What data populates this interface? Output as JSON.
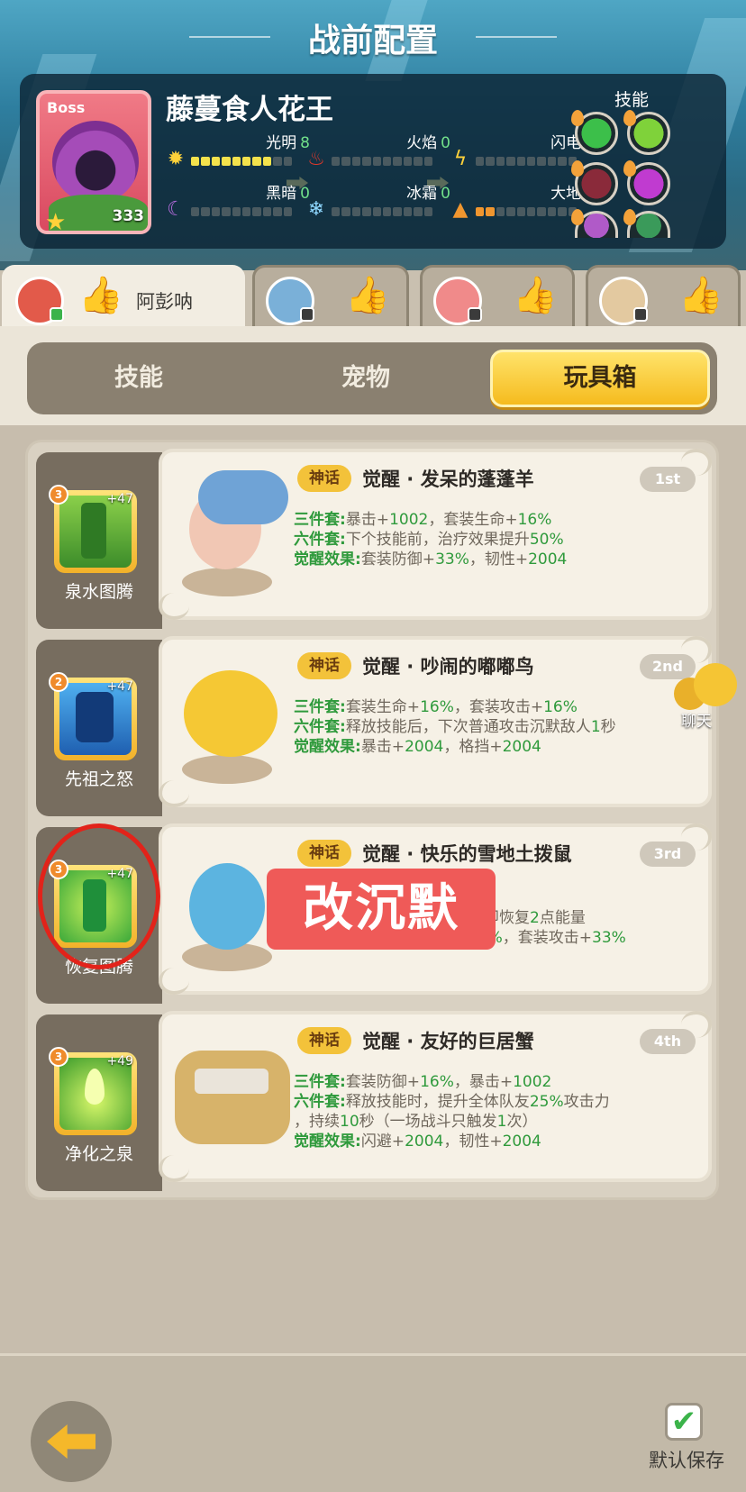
{
  "header": {
    "title": "战前配置"
  },
  "boss": {
    "tag": "Boss",
    "name": "藤蔓食人花王",
    "power": "333",
    "elements": [
      {
        "label": "光明",
        "value": "8",
        "icon": "sun-icon",
        "filled": 8
      },
      {
        "label": "火焰",
        "value": "0",
        "icon": "fire-icon",
        "filled": 0
      },
      {
        "label": "闪电",
        "value": "0",
        "icon": "lightning-icon",
        "filled": 0
      },
      {
        "label": "黑暗",
        "value": "0",
        "icon": "moon-icon",
        "filled": 0
      },
      {
        "label": "冰霜",
        "value": "0",
        "icon": "snowflake-icon",
        "filled": 0
      },
      {
        "label": "大地",
        "value": "2",
        "icon": "mountain-icon",
        "filled": 2
      }
    ],
    "skills_title": "技能",
    "skill_colors": [
      "#3cbf4a",
      "#7fd23a",
      "#8a2a3a",
      "#c03bd0",
      "#b05ac8",
      "#3a9a5a"
    ]
  },
  "players": [
    {
      "name": "阿彭呐",
      "active": true,
      "color": "#e25a4a"
    },
    {
      "name": "",
      "active": false,
      "color": "#7ab0d8"
    },
    {
      "name": "",
      "active": false,
      "color": "#f08a8a"
    },
    {
      "name": "",
      "active": false,
      "color": "#e3c9a0"
    }
  ],
  "tabs": {
    "skill": "技能",
    "pet": "宠物",
    "toybox": "玩具箱",
    "active": "toybox"
  },
  "toys": [
    {
      "name": "泉水图腾",
      "level": "3",
      "plus": "+47",
      "color": "#5fb83a",
      "badge": "神话",
      "title": "觉醒 · 发呆的蓬蓬羊",
      "rank": "1st",
      "l1k": "三件套:",
      "l1a": "暴击+",
      "l1b": "1002",
      "l1c": "，套装生命+",
      "l1d": "16%",
      "l2k": "六件套:",
      "l2a": "下个技能前，治疗效果提升",
      "l2b": "50%",
      "l3k": "觉醒效果:",
      "l3a": "套装防御+",
      "l3b": "33%",
      "l3c": "，韧性+",
      "l3d": "2004"
    },
    {
      "name": "先祖之怒",
      "level": "2",
      "plus": "+47",
      "color": "#2a8ad6",
      "badge": "神话",
      "title": "觉醒 · 吵闹的嘟嘟鸟",
      "rank": "2nd",
      "l1k": "三件套:",
      "l1a": "套装生命+",
      "l1b": "16%",
      "l1c": "，套装攻击+",
      "l1d": "16%",
      "l2k": "六件套:",
      "l2a": "释放技能后，下次普通攻击沉默敌人",
      "l2b": "1",
      "l2c": "秒",
      "l3k": "觉醒效果:",
      "l3a": "暴击+",
      "l3b": "2004",
      "l3c": "，格挡+",
      "l3d": "2004"
    },
    {
      "name": "恢复图腾",
      "level": "3",
      "plus": "+47",
      "color": "#3ec45a",
      "badge": "神话",
      "title": "觉醒 · 快乐的雪地土拨鼠",
      "rank": "3rd",
      "l1k": "",
      "l1a": "立即恢复",
      "l1b": "2",
      "l1c": "点能量",
      "l2k": "",
      "l2a": "33%",
      "l2b": "，套装攻击+",
      "l2c": "33%"
    },
    {
      "name": "净化之泉",
      "level": "3",
      "plus": "+49",
      "color": "#5ec83a",
      "badge": "神话",
      "title": "觉醒 · 友好的巨居蟹",
      "rank": "4th",
      "l1k": "三件套:",
      "l1a": "套装防御+",
      "l1b": "16%",
      "l1c": "，暴击+",
      "l1d": "1002",
      "l2k": "六件套:",
      "l2a": "释放技能时，提升全体队友",
      "l2b": "25%",
      "l2c": "攻击力",
      "l2e": "，持续",
      "l2f": "10",
      "l2g": "秒（一场战斗只触发",
      "l2h": "1",
      "l2i": "次）",
      "l3k": "觉醒效果:",
      "l3a": "闪避+",
      "l3b": "2004",
      "l3c": "，韧性+",
      "l3d": "2004"
    }
  ],
  "annotation": {
    "text": "改沉默",
    "color": "#e2231a"
  },
  "chat": {
    "label": "聊天"
  },
  "footer": {
    "save_label": "默认保存",
    "check": "✔"
  }
}
